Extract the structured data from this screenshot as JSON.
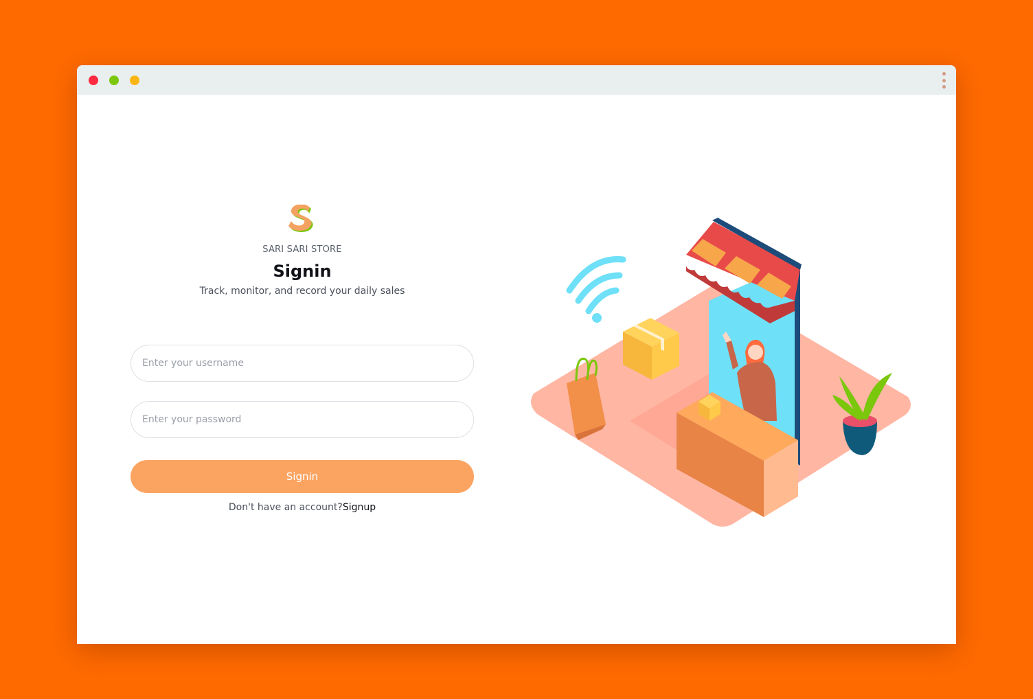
{
  "window": {
    "controls": {
      "close_color": "#fe2a3f",
      "minimize_color": "#7ac70c",
      "maximize_color": "#fbb613"
    },
    "menu_icon": "kebab-menu-icon"
  },
  "colors": {
    "background": "#ff6a00",
    "accent": "#fba462",
    "title": "#111318"
  },
  "login": {
    "logo_icon": "store-logo-icon",
    "brand": "SARI SARI STORE",
    "title": "Signin",
    "subtitle": "Track, monitor, and record your daily sales",
    "username_placeholder": "Enter your username",
    "password_placeholder": "Enter your password",
    "signin_label": "Signin",
    "no_account_text": "Don't have an account?",
    "signup_link": "Signup"
  },
  "illustration": {
    "icon": "store-shop-illustration"
  }
}
